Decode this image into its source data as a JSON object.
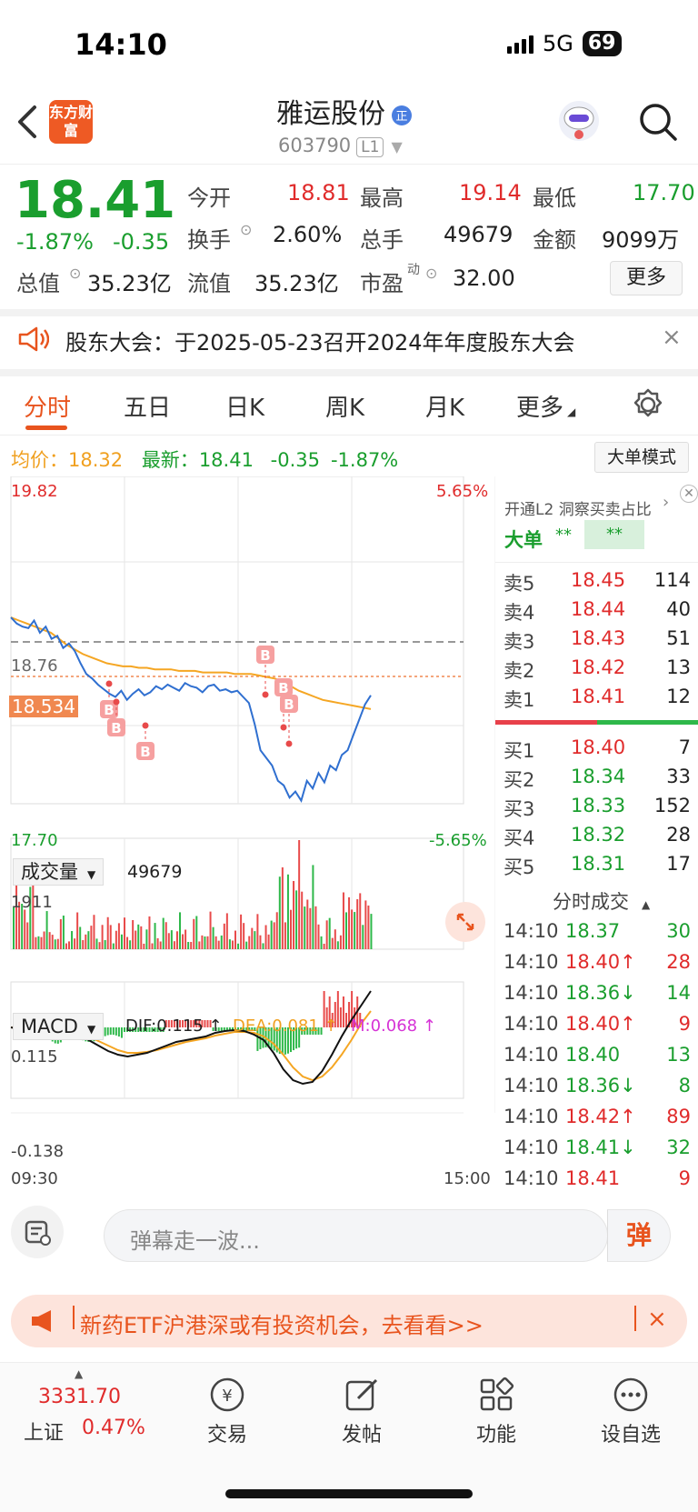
{
  "status_bar": {
    "time": "14:10",
    "network": "5G",
    "battery": "69"
  },
  "header": {
    "title": "雅运股份",
    "code": "603790",
    "level": "L1",
    "logo_text": "东方财富"
  },
  "quote": {
    "price": "18.41",
    "pct": "-1.87%",
    "change": "-0.35",
    "fields": [
      {
        "label": "今开",
        "value": "18.81",
        "color": "red"
      },
      {
        "label": "最高",
        "value": "19.14",
        "color": "red"
      },
      {
        "label": "最低",
        "value": "17.70",
        "color": "green"
      },
      {
        "label": "换手",
        "value": "2.60%",
        "color": "dark"
      },
      {
        "label": "总手",
        "value": "49679",
        "color": "dark"
      },
      {
        "label": "金额",
        "value": "9099万",
        "color": "dark"
      },
      {
        "label": "总值",
        "value": "35.23亿",
        "color": "dark"
      },
      {
        "label": "流值",
        "value": "35.23亿",
        "color": "dark"
      },
      {
        "label": "市盈",
        "value": "32.00",
        "color": "dark"
      }
    ],
    "pe_sup": "动",
    "more": "更多"
  },
  "notice": {
    "text": "股东大会：于2025-05-23召开2024年年度股东大会",
    "close": "×"
  },
  "tabs": [
    "分时",
    "五日",
    "日K",
    "周K",
    "月K",
    "更多"
  ],
  "info_line": {
    "avg_label": "均价：",
    "avg": "18.32",
    "latest_label": "最新：",
    "latest": "18.41",
    "change": "-0.35",
    "pct": "-1.87%"
  },
  "big_order_mode": "大单模式",
  "chart_data": {
    "type": "line",
    "title": "",
    "x_start": "09:30",
    "x_end": "15:00",
    "ylim": [
      17.7,
      19.82
    ],
    "y_top_label": "19.82",
    "y_bottom_label": "17.70",
    "pct_top": "5.65%",
    "pct_bottom": "-5.65%",
    "prev_close_label": "18.76",
    "current_marker": "18.534",
    "series": [
      {
        "name": "",
        "values": [
          18.92,
          18.88,
          18.86,
          18.85,
          18.9,
          18.82,
          18.86,
          18.78,
          18.8,
          18.72,
          18.75,
          18.7,
          18.62,
          18.55,
          18.52,
          18.48,
          18.45,
          18.42,
          18.4,
          18.44,
          18.38,
          18.42,
          18.45,
          18.41,
          18.43,
          18.47,
          18.45,
          18.48,
          18.46,
          18.44,
          18.49,
          18.47,
          18.46,
          18.43,
          18.47,
          18.48,
          18.44,
          18.45,
          18.43,
          18.44,
          18.4,
          18.36,
          18.22,
          18.05,
          18.0,
          17.95,
          17.85,
          17.82,
          17.74,
          17.78,
          17.72,
          17.85,
          17.8,
          17.9,
          17.84,
          17.95,
          17.92,
          18.02,
          18.05,
          18.15,
          18.25,
          18.35,
          18.41
        ]
      },
      {
        "name": "均价",
        "values": [
          18.92,
          18.9,
          18.88,
          18.86,
          18.84,
          18.82,
          18.78,
          18.74,
          18.71,
          18.68,
          18.66,
          18.64,
          18.62,
          18.61,
          18.6,
          18.6,
          18.59,
          18.59,
          18.58,
          18.58,
          18.58,
          18.57,
          18.57,
          18.57,
          18.56,
          18.56,
          18.56,
          18.56,
          18.55,
          18.55,
          18.55,
          18.54,
          18.53,
          18.52,
          18.5,
          18.47,
          18.44,
          18.42,
          18.4,
          18.38,
          18.37,
          18.36,
          18.35,
          18.34,
          18.33,
          18.32
        ]
      }
    ],
    "b_markers": [
      "B",
      "B",
      "B",
      "B",
      "B",
      "B"
    ],
    "volume_label": "成交量",
    "volume_total": "49679",
    "volume_max": "1911",
    "macd_label": "MACD",
    "dif": "DIF:0.115",
    "dea": "DEA:0.081",
    "m": "M:0.068",
    "macd_top": "0.115",
    "macd_bottom": "-0.138"
  },
  "right_panel": {
    "banner": "开通L2 洞察买卖占比",
    "big_order": "大单",
    "big_order_v1": "**",
    "big_order_v2": "**",
    "asks": [
      {
        "label": "卖5",
        "price": "18.45",
        "vol": "114"
      },
      {
        "label": "卖4",
        "price": "18.44",
        "vol": "40"
      },
      {
        "label": "卖3",
        "price": "18.43",
        "vol": "51"
      },
      {
        "label": "卖2",
        "price": "18.42",
        "vol": "13"
      },
      {
        "label": "卖1",
        "price": "18.41",
        "vol": "12"
      }
    ],
    "bids": [
      {
        "label": "买1",
        "price": "18.40",
        "vol": "7"
      },
      {
        "label": "买2",
        "price": "18.34",
        "vol": "33"
      },
      {
        "label": "买3",
        "price": "18.33",
        "vol": "152"
      },
      {
        "label": "买4",
        "price": "18.32",
        "vol": "28"
      },
      {
        "label": "买5",
        "price": "18.31",
        "vol": "17"
      }
    ],
    "ticks_title": "分时成交",
    "ticks": [
      {
        "time": "14:10",
        "price": "18.37",
        "vol": "30",
        "dir": "",
        "color": "green"
      },
      {
        "time": "14:10",
        "price": "18.40↑",
        "vol": "28",
        "dir": "",
        "color": "red"
      },
      {
        "time": "14:10",
        "price": "18.36↓",
        "vol": "14",
        "dir": "",
        "color": "green"
      },
      {
        "time": "14:10",
        "price": "18.40↑",
        "vol": "9",
        "dir": "",
        "color": "red"
      },
      {
        "time": "14:10",
        "price": "18.40",
        "vol": "13",
        "dir": "",
        "color": "green"
      },
      {
        "time": "14:10",
        "price": "18.36↓",
        "vol": "8",
        "dir": "",
        "color": "green"
      },
      {
        "time": "14:10",
        "price": "18.42↑",
        "vol": "89",
        "dir": "",
        "color": "red"
      },
      {
        "time": "14:10",
        "price": "18.41↓",
        "vol": "32",
        "dir": "",
        "color": "green"
      },
      {
        "time": "14:10",
        "price": "18.41",
        "vol": "9",
        "dir": "",
        "color": "red"
      }
    ]
  },
  "danmu": {
    "placeholder": "弹幕走一波...",
    "button": "弹"
  },
  "promo": {
    "text": "新药ETF沪港深或有投资机会，去看看>>",
    "close": "×"
  },
  "bottom_nav": {
    "index_value": "3331.70",
    "index_name": "上证",
    "index_pct": "0.47%",
    "items": [
      "交易",
      "发帖",
      "功能",
      "设自选"
    ]
  }
}
